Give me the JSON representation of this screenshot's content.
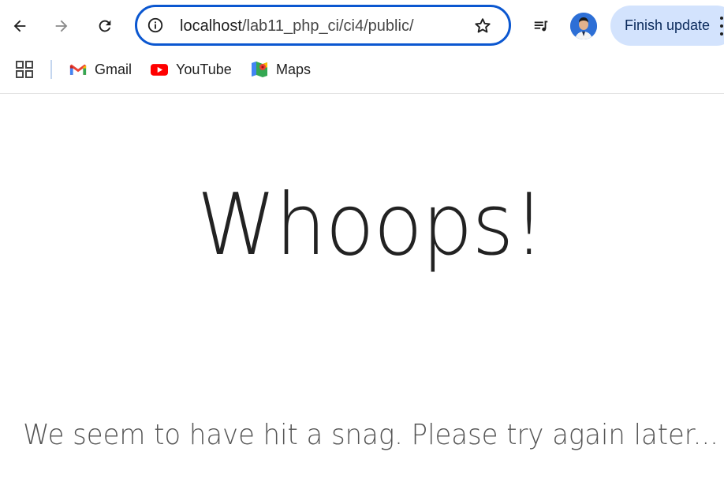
{
  "browser": {
    "url_host": "localhost",
    "url_path": "/lab11_php_ci/ci4/public/",
    "finish_update_label": "Finish update",
    "bookmarks": [
      {
        "label": "Gmail",
        "icon": "gmail-icon"
      },
      {
        "label": "YouTube",
        "icon": "youtube-icon"
      },
      {
        "label": "Maps",
        "icon": "maps-icon"
      }
    ],
    "accent_color": "#0b57d0",
    "update_button_color": "#d3e3fd"
  },
  "page": {
    "heading": "Whoops!",
    "message": "We seem to have hit a snag. Please try again later..."
  }
}
